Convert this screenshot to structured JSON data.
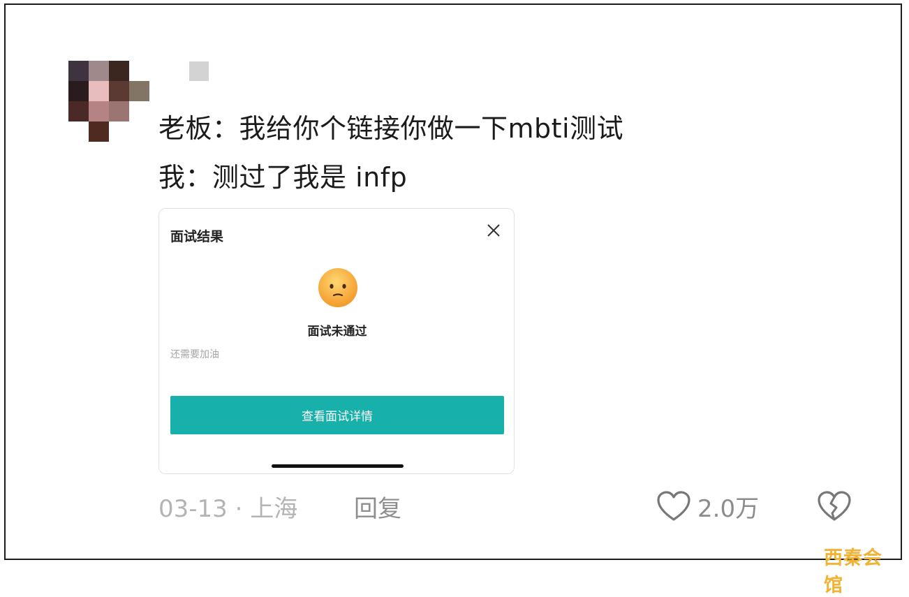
{
  "comment": {
    "line1": "老板：我给你个链接你做一下mbti测试",
    "line2": "我：测过了我是 infp"
  },
  "card": {
    "title": "面试结果",
    "result": "面试未通过",
    "hint": "还需要加油",
    "button_label": "查看面试详情"
  },
  "meta": {
    "date_location": "03-13 · 上海",
    "reply_label": "回复",
    "like_count": "2.0万"
  },
  "watermark": "西秦会馆",
  "colors": {
    "button": "#17b0aa",
    "watermark": "#f2b233",
    "face": "#f8b13c"
  },
  "icons": [
    "close-icon",
    "sad-face-icon",
    "heart-icon",
    "broken-heart-icon"
  ]
}
